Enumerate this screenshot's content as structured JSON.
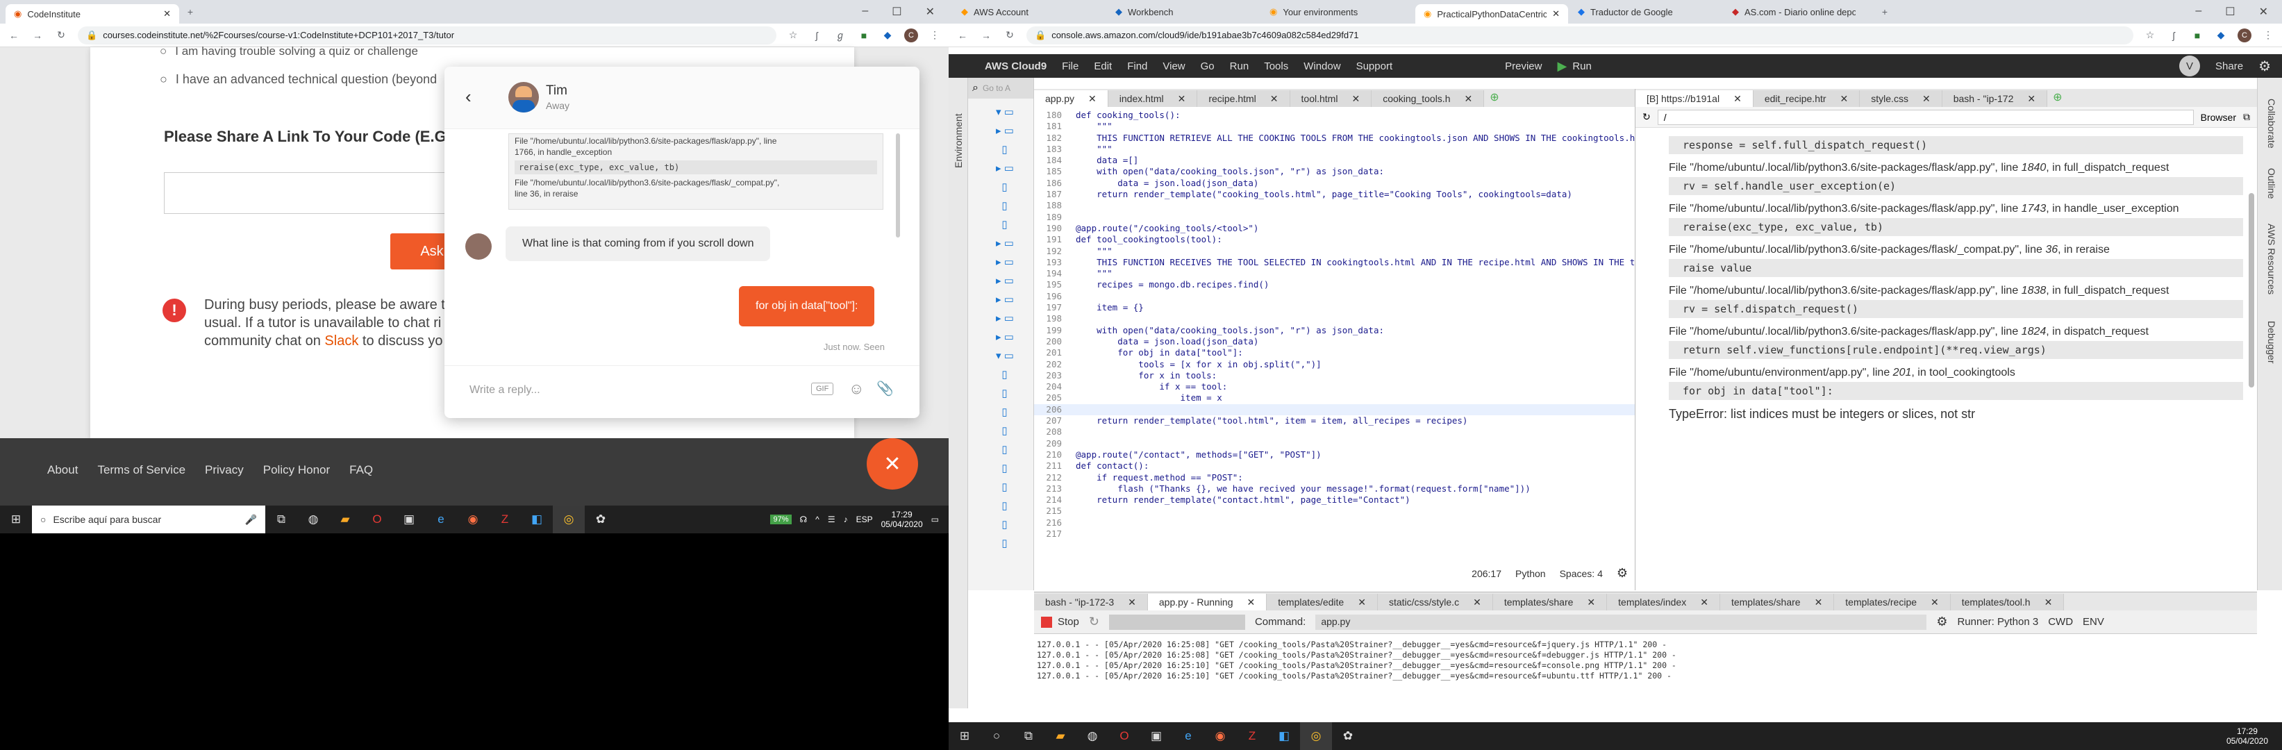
{
  "left_browser": {
    "tabs": [
      {
        "label": "CodeInstitute"
      }
    ],
    "url": "courses.codeinstitute.net/%2Fcourses/course-v1:CodeInstitute+DCP101+2017_T3/tutor",
    "page": {
      "option1": "I am having trouble solving a quiz or challenge",
      "option2": "I have an advanced technical question (beyond",
      "share_heading": "Please Share A Link To Your Code (E.G. G",
      "ask_button": "Ask",
      "busy_text_1": "During busy periods, please be aware t",
      "busy_text_2": "usual. If a tutor is unavailable to chat ri",
      "busy_text_3a": "community chat on ",
      "busy_text_slack": "Slack",
      "busy_text_3b": " to discuss yo"
    },
    "footer": {
      "links": [
        "About",
        "Terms of Service",
        "Privacy",
        "Policy Honor",
        "FAQ"
      ]
    },
    "chat": {
      "name": "Tim",
      "status": "Away",
      "snippet": [
        "File \"/home/ubuntu/.local/lib/python3.6/site-packages/flask/app.py\", line",
        "1766, in handle_exception",
        "reraise(exc_type, exc_value, tb)",
        "File \"/home/ubuntu/.local/lib/python3.6/site-packages/flask/_compat.py\",",
        "line 36, in reraise"
      ],
      "agent_message": "What line is that coming from if you scroll down",
      "user_message": "for obj in data[\"tool\"]:",
      "meta": "Just now. Seen",
      "input_placeholder": "Write a reply...",
      "gif": "GIF"
    },
    "taskbar": {
      "search_placeholder": "Escribe aquí para buscar",
      "lang": "ESP",
      "time": "17:29",
      "date": "05/04/2020",
      "battery": "97%"
    }
  },
  "right_browser": {
    "tabs": [
      {
        "label": "AWS Account"
      },
      {
        "label": "Workbench"
      },
      {
        "label": "Your environments"
      },
      {
        "label": "PracticalPythonDataCentricMiles"
      },
      {
        "label": "Traductor de Google"
      },
      {
        "label": "AS.com - Diario online deportivo"
      }
    ],
    "url": "console.aws.amazon.com/cloud9/ide/b191abae3b7c4609a082c584ed29fd71",
    "cloud9": {
      "menu": [
        "AWS Cloud9",
        "File",
        "Edit",
        "Find",
        "View",
        "Go",
        "Run",
        "Tools",
        "Window",
        "Support"
      ],
      "preview": "Preview",
      "run": "Run",
      "share": "Share",
      "goto": "Go to A",
      "side_labels_left": [
        "Environment"
      ],
      "side_labels_right": [
        "Collaborate",
        "Outline",
        "AWS Resources",
        "Debugger"
      ],
      "editor_tabs": [
        "app.py",
        "index.html",
        "recipe.html",
        "tool.html",
        "cooking_tools.h"
      ],
      "preview_tabs": [
        "[B] https://b191al",
        "edit_recipe.htr",
        "style.css",
        "bash - \"ip-172"
      ],
      "preview_url": "/",
      "preview_browser": "Browser",
      "code": [
        {
          "n": "180",
          "t": "def cooking_tools():"
        },
        {
          "n": "181",
          "t": "    \"\"\""
        },
        {
          "n": "182",
          "t": "    THIS FUNCTION RETRIEVE ALL THE COOKING TOOLS FROM THE cookingtools.json AND SHOWS IN THE cookingtools.h"
        },
        {
          "n": "183",
          "t": "    \"\"\""
        },
        {
          "n": "184",
          "t": "    data =[]"
        },
        {
          "n": "185",
          "t": "    with open(\"data/cooking_tools.json\", \"r\") as json_data:"
        },
        {
          "n": "186",
          "t": "        data = json.load(json_data)"
        },
        {
          "n": "187",
          "t": "    return render_template(\"cooking_tools.html\", page_title=\"Cooking Tools\", cookingtools=data)"
        },
        {
          "n": "188",
          "t": ""
        },
        {
          "n": "189",
          "t": ""
        },
        {
          "n": "190",
          "t": "@app.route(\"/cooking_tools/<tool>\")"
        },
        {
          "n": "191",
          "t": "def tool_cookingtools(tool):"
        },
        {
          "n": "192",
          "t": "    \"\"\""
        },
        {
          "n": "193",
          "t": "    THIS FUNCTION RECEIVES THE TOOL SELECTED IN cookingtools.html AND IN THE recipe.html AND SHOWS IN THE t"
        },
        {
          "n": "194",
          "t": "    \"\"\""
        },
        {
          "n": "195",
          "t": "    recipes = mongo.db.recipes.find()"
        },
        {
          "n": "196",
          "t": ""
        },
        {
          "n": "197",
          "t": "    item = {}"
        },
        {
          "n": "198",
          "t": ""
        },
        {
          "n": "199",
          "t": "    with open(\"data/cooking_tools.json\", \"r\") as json_data:"
        },
        {
          "n": "200",
          "t": "        data = json.load(json_data)"
        },
        {
          "n": "201",
          "t": "        for obj in data[\"tool\"]:"
        },
        {
          "n": "202",
          "t": "            tools = [x for x in obj.split(\",\")]"
        },
        {
          "n": "203",
          "t": "            for x in tools:"
        },
        {
          "n": "204",
          "t": "                if x == tool:"
        },
        {
          "n": "205",
          "t": "                    item = x"
        },
        {
          "n": "206",
          "t": ""
        },
        {
          "n": "207",
          "t": "    return render_template(\"tool.html\", item = item, all_recipes = recipes)"
        },
        {
          "n": "208",
          "t": ""
        },
        {
          "n": "209",
          "t": ""
        },
        {
          "n": "210",
          "t": "@app.route(\"/contact\", methods=[\"GET\", \"POST\"])"
        },
        {
          "n": "211",
          "t": "def contact():"
        },
        {
          "n": "212",
          "t": "    if request.method == \"POST\":"
        },
        {
          "n": "213",
          "t": "        flash (\"Thanks {}, we have recived your message!\".format(request.form[\"name\"]))"
        },
        {
          "n": "214",
          "t": "    return render_template(\"contact.html\", page_title=\"Contact\")"
        },
        {
          "n": "215",
          "t": ""
        },
        {
          "n": "216",
          "t": ""
        },
        {
          "n": "217",
          "t": ""
        }
      ],
      "status": {
        "pos": "206:17",
        "lang": "Python",
        "spaces": "Spaces: 4"
      },
      "traceback": [
        {
          "kind": "code",
          "text": "response = self.full_dispatch_request()"
        },
        {
          "kind": "file",
          "path": "\"/home/ubuntu/.local/lib/python3.6/site-packages/flask/app.py\"",
          "line": "1840",
          "fn": "full_dispatch_request"
        },
        {
          "kind": "code",
          "text": "rv = self.handle_user_exception(e)"
        },
        {
          "kind": "file",
          "path": "\"/home/ubuntu/.local/lib/python3.6/site-packages/flask/app.py\"",
          "line": "1743",
          "fn": "handle_user_exception"
        },
        {
          "kind": "code",
          "text": "reraise(exc_type, exc_value, tb)"
        },
        {
          "kind": "file",
          "path": "\"/home/ubuntu/.local/lib/python3.6/site-packages/flask/_compat.py\"",
          "line": "36",
          "fn": "reraise"
        },
        {
          "kind": "code",
          "text": "raise value"
        },
        {
          "kind": "file",
          "path": "\"/home/ubuntu/.local/lib/python3.6/site-packages/flask/app.py\"",
          "line": "1838",
          "fn": "full_dispatch_request"
        },
        {
          "kind": "code",
          "text": "rv = self.dispatch_request()"
        },
        {
          "kind": "file",
          "path": "\"/home/ubuntu/.local/lib/python3.6/site-packages/flask/app.py\"",
          "line": "1824",
          "fn": "dispatch_request"
        },
        {
          "kind": "code",
          "text": "return self.view_functions[rule.endpoint](**req.view_args)"
        },
        {
          "kind": "file",
          "path": "\"/home/ubuntu/environment/app.py\"",
          "line": "201",
          "fn": "tool_cookingtools"
        },
        {
          "kind": "code",
          "text": "for obj in data[\"tool\"]:"
        }
      ],
      "error": "TypeError: list indices must be integers or slices, not str",
      "terminal_tabs": [
        "bash - \"ip-172-3",
        "app.py - Running",
        "templates/edite",
        "static/css/style.c",
        "templates/share",
        "templates/index",
        "templates/share",
        "templates/recipe",
        "templates/tool.h"
      ],
      "run_panel": {
        "stop": "Stop",
        "command_label": "Command:",
        "command": "app.py",
        "runner": "Runner: Python 3",
        "cwd": "CWD",
        "env": "ENV"
      },
      "log": [
        "127.0.0.1 - - [05/Apr/2020 16:25:08] \"GET /cooking_tools/Pasta%20Strainer?__debugger__=yes&cmd=resource&f=jquery.js HTTP/1.1\" 200 -",
        "127.0.0.1 - - [05/Apr/2020 16:25:08] \"GET /cooking_tools/Pasta%20Strainer?__debugger__=yes&cmd=resource&f=debugger.js HTTP/1.1\" 200 -",
        "127.0.0.1 - - [05/Apr/2020 16:25:10] \"GET /cooking_tools/Pasta%20Strainer?__debugger__=yes&cmd=resource&f=console.png HTTP/1.1\" 200 -",
        "127.0.0.1 - - [05/Apr/2020 16:25:10] \"GET /cooking_tools/Pasta%20Strainer?__debugger__=yes&cmd=resource&f=ubuntu.ttf HTTP/1.1\" 200 -"
      ]
    },
    "taskbar": {
      "time": "17:29",
      "date": "05/04/2020"
    }
  },
  "colors": {
    "orange": "#f05a28",
    "cloud9_dark": "#2b2b2b",
    "chat_bubble": "#f0f0f0"
  }
}
